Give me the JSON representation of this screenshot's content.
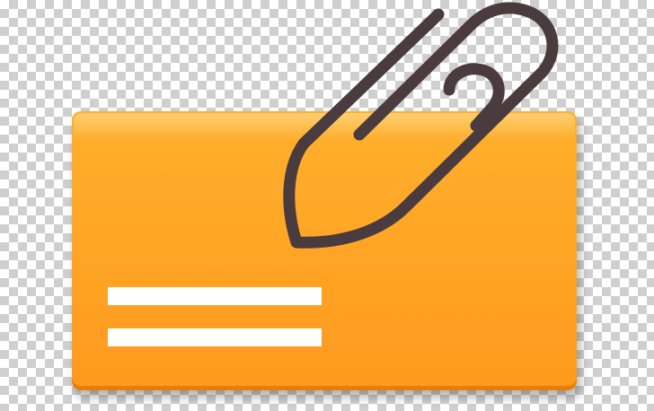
{
  "icon": {
    "name": "attachment-card-icon",
    "card_color_top": "#FFB02E",
    "card_color_bottom": "#FF9A1E",
    "card_edge_color": "#E67E10",
    "lines_color": "#FFFFFF",
    "paperclip_color": "#4A3B3E"
  }
}
